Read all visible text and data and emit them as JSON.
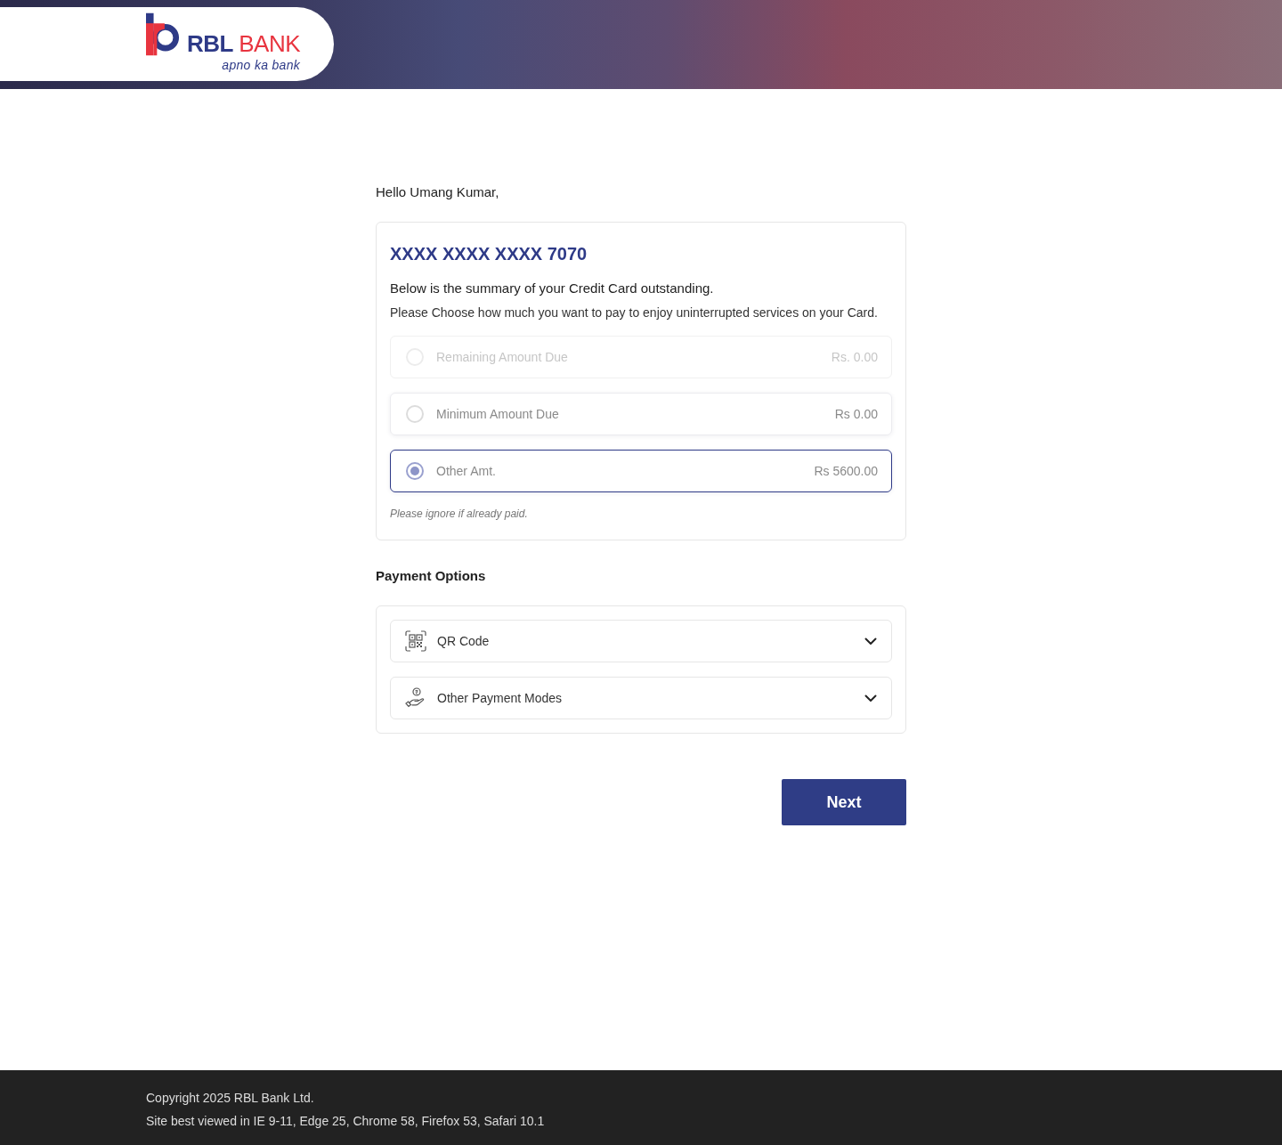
{
  "header": {
    "logo": {
      "wordmark": [
        "RBL",
        "BANK"
      ],
      "tagline": "apno ka bank"
    }
  },
  "greeting": "Hello Umang Kumar,",
  "summary_card": {
    "card_number": "XXXX XXXX XXXX 7070",
    "heading": "Below is the summary of your Credit Card outstanding.",
    "instruction": "Please Choose how much you want to pay to enjoy uninterrupted services on your Card.",
    "amount_options": [
      {
        "label": "Remaining Amount Due",
        "amount": "Rs. 0.00",
        "selected": false,
        "disabled": true
      },
      {
        "label": "Minimum Amount Due",
        "amount": "Rs 0.00",
        "selected": false,
        "disabled": false
      },
      {
        "label": "Other Amt.",
        "amount": "Rs 5600.00",
        "selected": true,
        "disabled": false
      }
    ],
    "note": "Please ignore if already paid."
  },
  "payment_options": {
    "title": "Payment Options",
    "items": [
      {
        "kind": "qr",
        "label": "QR Code",
        "expanded": false
      },
      {
        "kind": "hand",
        "label": "Other Payment Modes",
        "expanded": false
      }
    ]
  },
  "next_button": "Next",
  "footer": {
    "lines": [
      "Copyright 2025 RBL Bank Ltd.",
      "Site best viewed in IE 9-11, Edge 25, Chrome 58, Firefox 53, Safari 10.1"
    ]
  }
}
